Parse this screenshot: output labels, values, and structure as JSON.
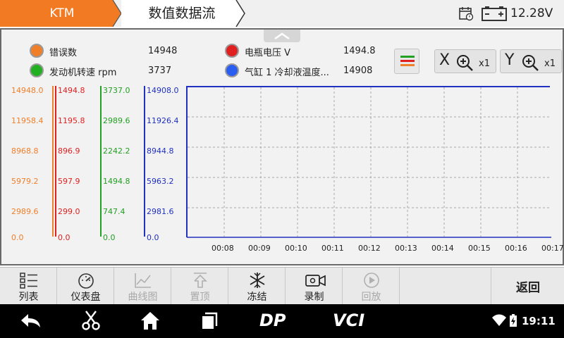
{
  "header": {
    "brand_tab": "KTM",
    "title": "数值数据流",
    "voltage": "12.28V",
    "icons": [
      "calendar-icon",
      "battery-icon"
    ]
  },
  "legend": [
    {
      "label": "错误数",
      "value": "14948",
      "color": "#f07f2a"
    },
    {
      "label": "发动机转速 rpm",
      "value": "3737",
      "color": "#22b022"
    },
    {
      "label": "电瓶电压 V",
      "value": "1494.8",
      "color": "#e02020"
    },
    {
      "label": "气缸 1 冷却液温度...",
      "value": "14908",
      "color": "#2a5ef0"
    }
  ],
  "controls": {
    "menu_icon": "menu-lines-icon",
    "x_zoom": {
      "axis": "X",
      "multiplier": "x1"
    },
    "y_zoom": {
      "axis": "Y",
      "multiplier": "x1"
    }
  },
  "scales": [
    {
      "color": "#f07f2a",
      "ticks": [
        "14948.0",
        "11958.4",
        "8968.8",
        "5979.2",
        "2989.6",
        "0.0"
      ]
    },
    {
      "color": "#e02020",
      "ticks": [
        "1494.8",
        "1195.8",
        "896.9",
        "597.9",
        "299.0",
        "0.0"
      ]
    },
    {
      "color": "#22a022",
      "ticks": [
        "3737.0",
        "2989.6",
        "2242.2",
        "1494.8",
        "747.4",
        "0.0"
      ]
    },
    {
      "color": "#2030c0",
      "ticks": [
        "14908.0",
        "11926.4",
        "8944.8",
        "5963.2",
        "2981.6",
        "0.0"
      ]
    }
  ],
  "chart": {
    "x_ticks": [
      "00:08",
      "00:09",
      "00:10",
      "00:11",
      "00:12",
      "00:13",
      "00:14",
      "00:15",
      "00:16",
      "00:17"
    ],
    "grid": true,
    "visible_line_color": "#2030c0"
  },
  "toolbar": [
    {
      "label": "列表",
      "icon": "list-icon",
      "enabled": true
    },
    {
      "label": "仪表盘",
      "icon": "gauge-icon",
      "enabled": true
    },
    {
      "label": "曲线图",
      "icon": "line-chart-icon",
      "enabled": false
    },
    {
      "label": "置顶",
      "icon": "pin-top-icon",
      "enabled": false
    },
    {
      "label": "冻结",
      "icon": "snowflake-icon",
      "enabled": true
    },
    {
      "label": "录制",
      "icon": "record-video-icon",
      "enabled": true
    },
    {
      "label": "回放",
      "icon": "playback-icon",
      "enabled": false
    }
  ],
  "back_label": "返回",
  "navbar": {
    "time": "19:11",
    "icons": [
      "back-arrow-icon",
      "scissors-icon",
      "home-icon",
      "recents-icon",
      "dp-logo",
      "vci-logo",
      "wifi-icon",
      "battery-charging-icon"
    ],
    "dp_text": "DP",
    "vci_text": "VCI"
  }
}
